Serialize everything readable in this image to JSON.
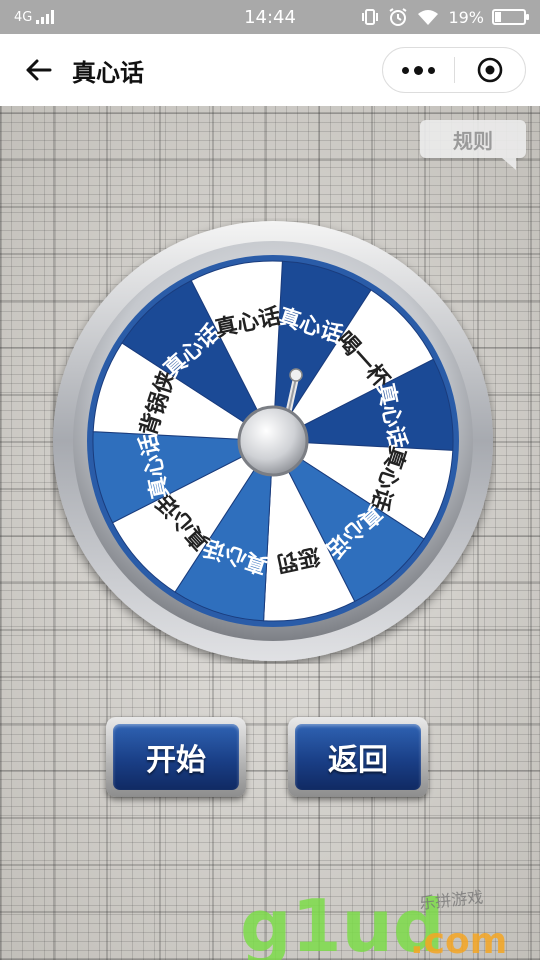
{
  "status_bar": {
    "network": "4G",
    "time": "14:44",
    "battery": "19%"
  },
  "nav": {
    "title": "真心话"
  },
  "rules_label": "规则",
  "wheel": {
    "segments": [
      "真心话",
      "喝一杯",
      "真心话",
      "真心话",
      "真心话",
      "惩罚",
      "真心话",
      "真心话",
      "真心话",
      "背锅侠",
      "真心话",
      "真心话"
    ],
    "colors": {
      "dark_blue": "#1b4a96",
      "light_blue": "#2f6fbd",
      "white": "#ffffff",
      "rim": "#b9bcc2"
    }
  },
  "buttons": {
    "start": "开始",
    "return": "返回"
  },
  "watermark": {
    "logo": "g1ud",
    "suffix": ".com",
    "tagline": "乐拼游戏"
  },
  "icons": {
    "back": "arrow-left-icon",
    "more": "more-dots-icon",
    "close": "target-close-icon"
  }
}
